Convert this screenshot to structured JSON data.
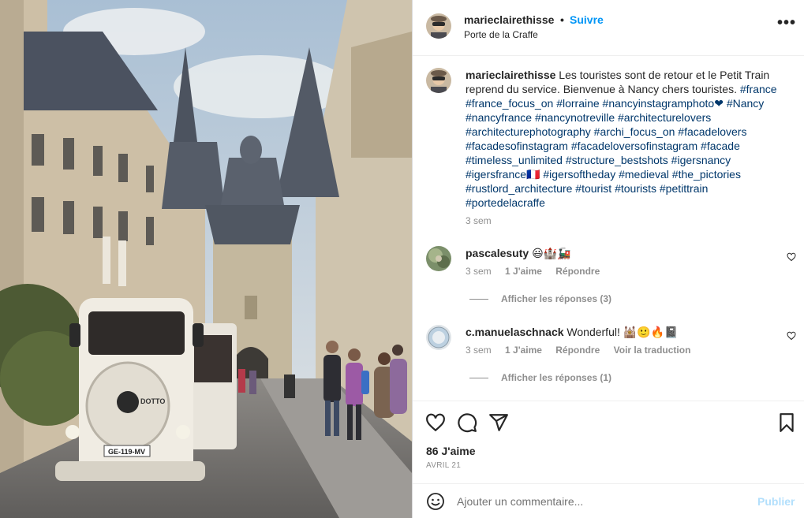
{
  "post": {
    "author": "marieclairethisse",
    "separator": "•",
    "follow_label": "Suivre",
    "location": "Porte de la Craffe",
    "more_label": "•••",
    "photo_plate": "GE-119-MV",
    "photo_brand": "DOTTO"
  },
  "caption": {
    "author": "marieclairethisse",
    "text": "Les touristes sont de retour et le Petit Train reprend du service. Bienvenue à Nancy chers touristes.",
    "hashtags": "#france #france_focus_on #lorraine #nancyinstagramphoto❤ #Nancy #nancyfrance #nancynotreville #architecturelovers #architecturephotography #archi_focus_on #facadelovers #facadesofinstagram #facadeloversofinstagram #facade #timeless_unlimited #structure_bestshots #igersnancy #igersfrance🇫🇷 #igersoftheday #medieval #the_pictories #rustlord_architecture #tourist #tourists #petittrain #portedelacraffe",
    "time": "3 sem"
  },
  "comments": [
    {
      "author": "pascalesuty",
      "text": "😃🏰🚂",
      "time": "3 sem",
      "likes": "1 J'aime",
      "reply": "Répondre",
      "translate": "",
      "replies": "Afficher les réponses (3)"
    },
    {
      "author": "c.manuelaschnack",
      "text": "Wonderful! 🕍🙂🔥📓",
      "time": "3 sem",
      "likes": "1 J'aime",
      "reply": "Répondre",
      "translate": "Voir la traduction",
      "replies": "Afficher les réponses (1)"
    }
  ],
  "actions": {
    "likes": "86 J'aime",
    "date": "AVRIL 21"
  },
  "add_comment": {
    "placeholder": "Ajouter un commentaire...",
    "publish_label": "Publier"
  },
  "colors": {
    "link_blue": "#0095f6",
    "hashtag_blue": "#00376b",
    "publish_disabled": "#b2dffc",
    "muted": "#8e8e8e"
  }
}
